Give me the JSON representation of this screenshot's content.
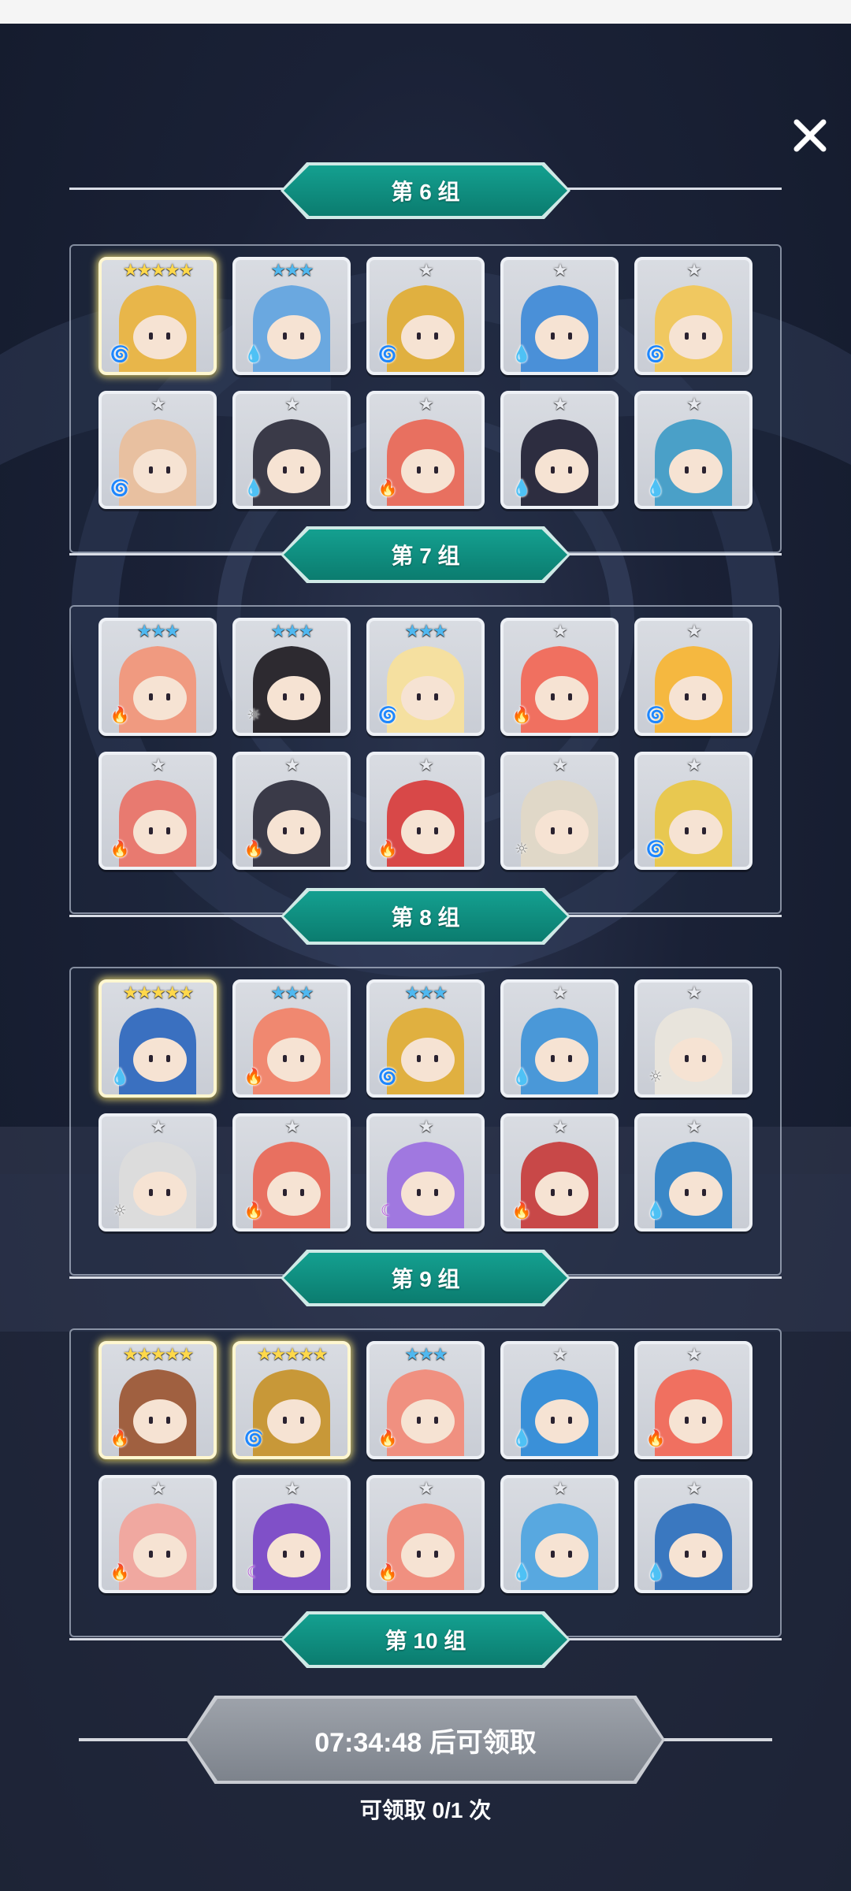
{
  "header": {
    "close_icon": "close-icon"
  },
  "groups": [
    {
      "label": "第 6 组"
    },
    {
      "label": "第 7 组"
    },
    {
      "label": "第 8 组"
    },
    {
      "label": "第 9 组"
    },
    {
      "label": "第 10 组"
    }
  ],
  "panels": [
    {
      "heroes": [
        {
          "stars": "★★★★★",
          "star_color": "gold",
          "element": "wind",
          "hair": "#e8b64a",
          "gold": true
        },
        {
          "stars": "★★★",
          "star_color": "blue",
          "element": "water",
          "hair": "#6aa8e0"
        },
        {
          "stars": "★",
          "star_color": "silver",
          "element": "wind",
          "hair": "#e0b040"
        },
        {
          "stars": "★",
          "star_color": "silver",
          "element": "water",
          "hair": "#4a90d8"
        },
        {
          "stars": "★",
          "star_color": "silver",
          "element": "wind",
          "hair": "#f0c860"
        },
        {
          "stars": "★",
          "star_color": "silver",
          "element": "wind",
          "hair": "#e8c0a0"
        },
        {
          "stars": "★",
          "star_color": "silver",
          "element": "water",
          "hair": "#3a3a48"
        },
        {
          "stars": "★",
          "star_color": "silver",
          "element": "fire",
          "hair": "#e87060"
        },
        {
          "stars": "★",
          "star_color": "silver",
          "element": "water",
          "hair": "#2d2d40"
        },
        {
          "stars": "★",
          "star_color": "silver",
          "element": "water",
          "hair": "#4aa0c8"
        }
      ]
    },
    {
      "heroes": [
        {
          "stars": "★★★",
          "star_color": "blue",
          "element": "fire",
          "hair": "#f09a80"
        },
        {
          "stars": "★★★",
          "star_color": "blue",
          "element": "light",
          "hair": "#2d2a30"
        },
        {
          "stars": "★★★",
          "star_color": "blue",
          "element": "wind",
          "hair": "#f5e0a0"
        },
        {
          "stars": "★",
          "star_color": "silver",
          "element": "fire",
          "hair": "#f07060"
        },
        {
          "stars": "★",
          "star_color": "silver",
          "element": "wind",
          "hair": "#f5b840"
        },
        {
          "stars": "★",
          "star_color": "silver",
          "element": "fire",
          "hair": "#e87a70"
        },
        {
          "stars": "★",
          "star_color": "silver",
          "element": "fire",
          "hair": "#3a3a48"
        },
        {
          "stars": "★",
          "star_color": "silver",
          "element": "fire",
          "hair": "#d84848"
        },
        {
          "stars": "★",
          "star_color": "silver",
          "element": "light",
          "hair": "#e0d8c8"
        },
        {
          "stars": "★",
          "star_color": "silver",
          "element": "wind",
          "hair": "#e8c850"
        }
      ]
    },
    {
      "heroes": [
        {
          "stars": "★★★★★",
          "star_color": "gold",
          "element": "water",
          "hair": "#3a70c0",
          "gold": true
        },
        {
          "stars": "★★★",
          "star_color": "blue",
          "element": "fire",
          "hair": "#f08870"
        },
        {
          "stars": "★★★",
          "star_color": "blue",
          "element": "wind",
          "hair": "#e0b040"
        },
        {
          "stars": "★",
          "star_color": "silver",
          "element": "water",
          "hair": "#4a98d8"
        },
        {
          "stars": "★",
          "star_color": "silver",
          "element": "light",
          "hair": "#e8e4dc"
        },
        {
          "stars": "★",
          "star_color": "silver",
          "element": "light",
          "hair": "#dcdcdc"
        },
        {
          "stars": "★",
          "star_color": "silver",
          "element": "fire",
          "hair": "#e87060"
        },
        {
          "stars": "★",
          "star_color": "silver",
          "element": "dark",
          "hair": "#a078e0"
        },
        {
          "stars": "★",
          "star_color": "silver",
          "element": "fire",
          "hair": "#c84848"
        },
        {
          "stars": "★",
          "star_color": "silver",
          "element": "water",
          "hair": "#3a88c8"
        }
      ]
    },
    {
      "heroes": [
        {
          "stars": "★★★★★",
          "star_color": "gold",
          "element": "fire",
          "hair": "#a06040",
          "gold": true
        },
        {
          "stars": "★★★★★",
          "star_color": "gold",
          "element": "wind",
          "hair": "#c89838",
          "gold": true
        },
        {
          "stars": "★★★",
          "star_color": "blue",
          "element": "fire",
          "hair": "#f09080"
        },
        {
          "stars": "★",
          "star_color": "silver",
          "element": "water",
          "hair": "#3a90d8"
        },
        {
          "stars": "★",
          "star_color": "silver",
          "element": "fire",
          "hair": "#f07060"
        },
        {
          "stars": "★",
          "star_color": "silver",
          "element": "fire",
          "hair": "#f0a8a0"
        },
        {
          "stars": "★",
          "star_color": "silver",
          "element": "dark",
          "hair": "#8050c8"
        },
        {
          "stars": "★",
          "star_color": "silver",
          "element": "fire",
          "hair": "#f09080"
        },
        {
          "stars": "★",
          "star_color": "silver",
          "element": "water",
          "hair": "#58a8e0"
        },
        {
          "stars": "★",
          "star_color": "silver",
          "element": "water",
          "hair": "#3a78c0"
        }
      ]
    }
  ],
  "claim": {
    "button_label": "07:34:48 后可领取",
    "count_label": "可领取 0/1 次"
  }
}
